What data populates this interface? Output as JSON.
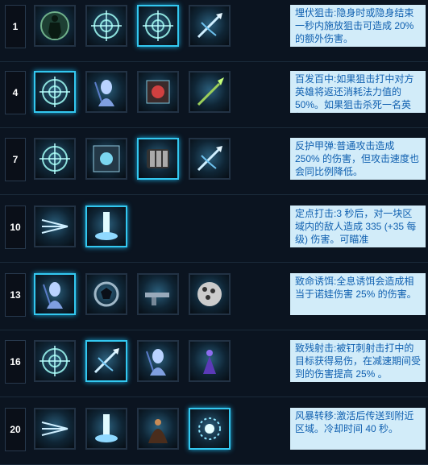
{
  "rows": [
    {
      "level": "1",
      "desc": "埋伏狙击:隐身时或隐身结束一秒内施放狙击可造成 20% 的额外伤害。"
    },
    {
      "level": "4",
      "desc": "百发百中:如果狙击打中对方英雄将返还消耗法力值的 50%。如果狙击杀死一名英雄，"
    },
    {
      "level": "7",
      "desc": "反护甲弹:普通攻击造成 250% 的伤害，但攻击速度也会同比例降低。"
    },
    {
      "level": "10",
      "desc": "定点打击:3 秒后，对一块区域内的敌人造成 335 (+35 每级) 伤害。可瞄准"
    },
    {
      "level": "13",
      "desc": "致命诱饵:全息诱饵会造成相当于诺娃伤害 25% 的伤害。"
    },
    {
      "level": "16",
      "desc": "致残射击:被钉刺射击打中的目标获得易伤，在减速期间受到的伤害提高 25% 。"
    },
    {
      "level": "20",
      "desc": "风暴转移:激活后传送到附近区域。冷却时间 40 秒。"
    }
  ],
  "icons": {
    "r1": [
      "stealth-figure-icon",
      "crosshair-icon",
      "crosshair-icon",
      "dart-icon"
    ],
    "r4": [
      "crosshair-icon",
      "holo-decoy-icon",
      "chest-core-icon",
      "spear-icon"
    ],
    "r7": [
      "crosshair-icon",
      "armor-panel-icon",
      "ammo-clip-icon",
      "dart-icon"
    ],
    "r10": [
      "triple-shot-icon",
      "beam-strike-icon"
    ],
    "r13": [
      "holo-decoy-icon",
      "target-ring-icon",
      "rifle-icon",
      "sphere-cage-icon"
    ],
    "r16": [
      "crosshair-icon",
      "dart-icon",
      "holo-decoy-icon",
      "shadow-figure-icon"
    ],
    "r20": [
      "triple-shot-icon",
      "beam-strike-icon",
      "cloak-figure-icon",
      "burst-ring-icon"
    ]
  },
  "selected": {
    "r1": 2,
    "r4": 0,
    "r7": 2,
    "r10": 1,
    "r13": 0,
    "r16": 1,
    "r20": 3
  }
}
